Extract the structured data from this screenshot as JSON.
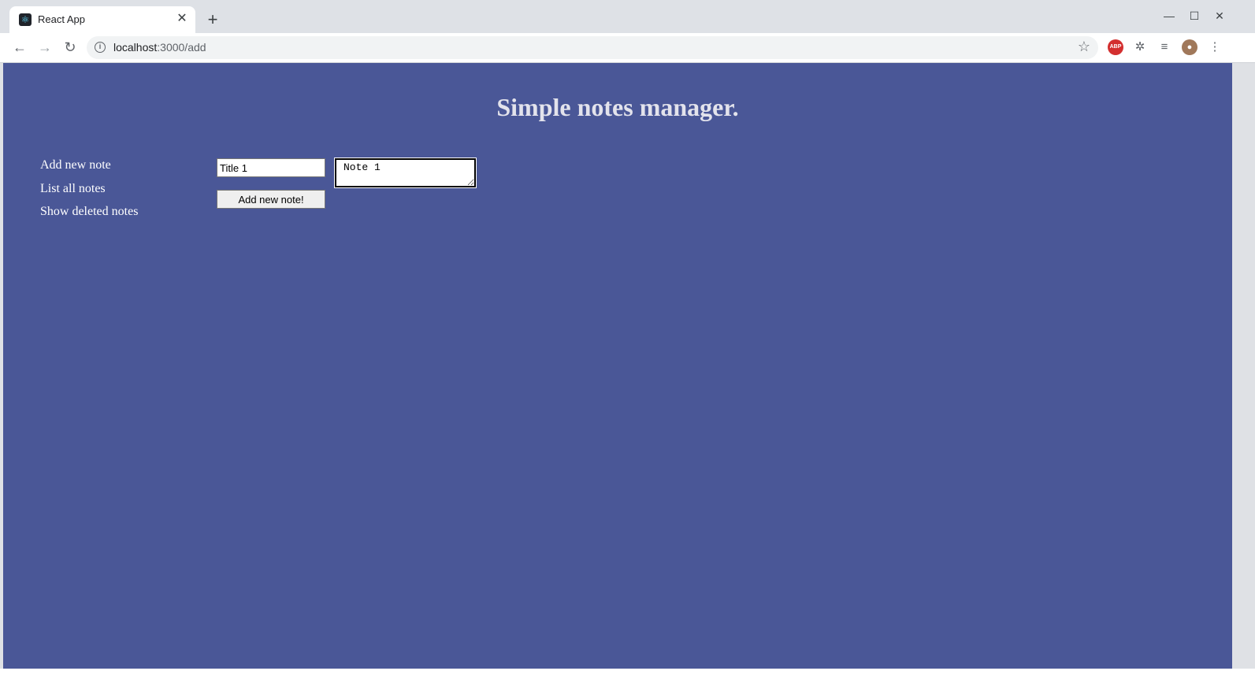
{
  "browser": {
    "tab_title": "React App",
    "favicon": "react-logo-icon",
    "url_host": "localhost",
    "url_rest": ":3000/add",
    "extensions": [
      "abp-icon",
      "puzzle-icon",
      "media-icon",
      "avatar"
    ],
    "abp_label": "ABP"
  },
  "page": {
    "heading": "Simple notes manager.",
    "background": "#4a5797",
    "nav": {
      "add": "Add new note",
      "list": "List all notes",
      "deleted": "Show deleted notes"
    },
    "form": {
      "title_value": "Title 1",
      "note_value": "Note 1",
      "submit_label": "Add new note!"
    }
  }
}
